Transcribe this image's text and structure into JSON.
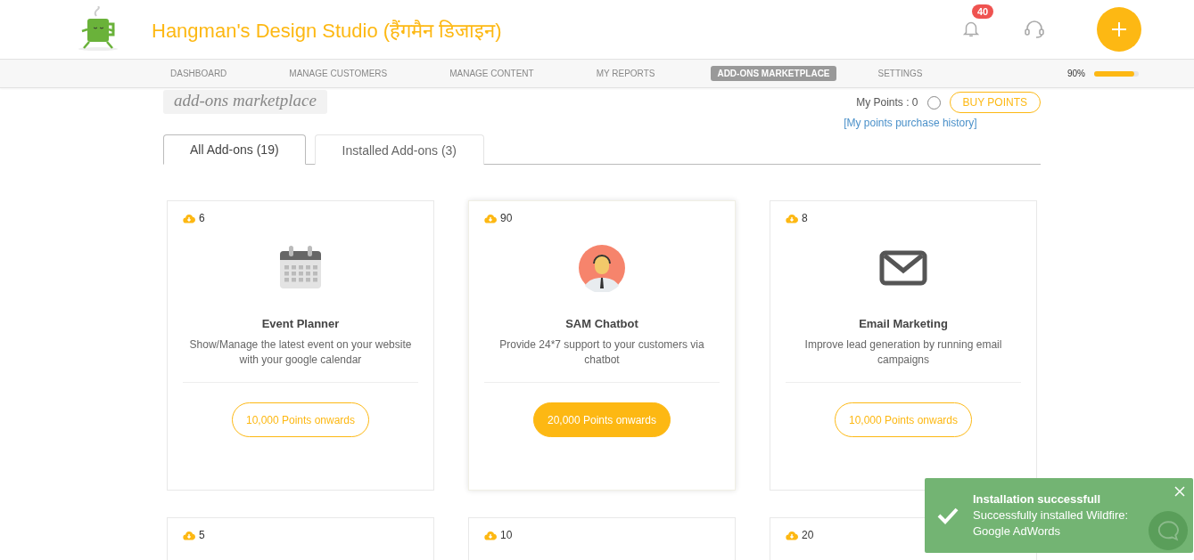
{
  "header": {
    "title": "Hangman's Design Studio (हैंगमैन डिजाइन)",
    "notifications": "40"
  },
  "nav": {
    "items": [
      {
        "label": "DASHBOARD",
        "selected": false
      },
      {
        "label": "MANAGE CUSTOMERS",
        "selected": false
      },
      {
        "label": "MANAGE CONTENT",
        "selected": false
      },
      {
        "label": "MY REPORTS",
        "selected": false
      },
      {
        "label": "ADD-ONS MARKETPLACE",
        "selected": true
      },
      {
        "label": "SETTINGS",
        "selected": false
      }
    ],
    "progress": {
      "reading": "90%",
      "level": 0.9
    }
  },
  "page": {
    "title": "add-ons marketplace",
    "points_label": "My Points : 0",
    "buy_button": "BUY POINTS",
    "history_link": "[My points purchase history]"
  },
  "tabs": [
    {
      "label": "All Add-ons (19)",
      "selected": true
    },
    {
      "label": "Installed Add-ons (3)",
      "selected": false
    }
  ],
  "cards": [
    {
      "downloads": "6",
      "kind": "calendar",
      "title": "Event Planner",
      "description": "Show/Manage the latest event on your website with your google calendar",
      "price": "10,000 Points onwards",
      "highlighted": false
    },
    {
      "downloads": "90",
      "kind": "agent",
      "title": "SAM Chatbot",
      "description": "Provide 24*7 support to your customers via chatbot",
      "price": "20,000 Points onwards",
      "highlighted": true
    },
    {
      "downloads": "8",
      "kind": "mail",
      "title": "Email Marketing",
      "description": "Improve lead generation by running email campaigns",
      "price": "10,000 Points onwards",
      "highlighted": false
    },
    {
      "downloads": "5",
      "highlighted": false
    },
    {
      "downloads": "10",
      "highlighted": false
    },
    {
      "downloads": "20",
      "highlighted": false
    }
  ],
  "toast": {
    "title": "Installation successfull",
    "message": "Successfully installed Wildfire: Google AdWords"
  }
}
